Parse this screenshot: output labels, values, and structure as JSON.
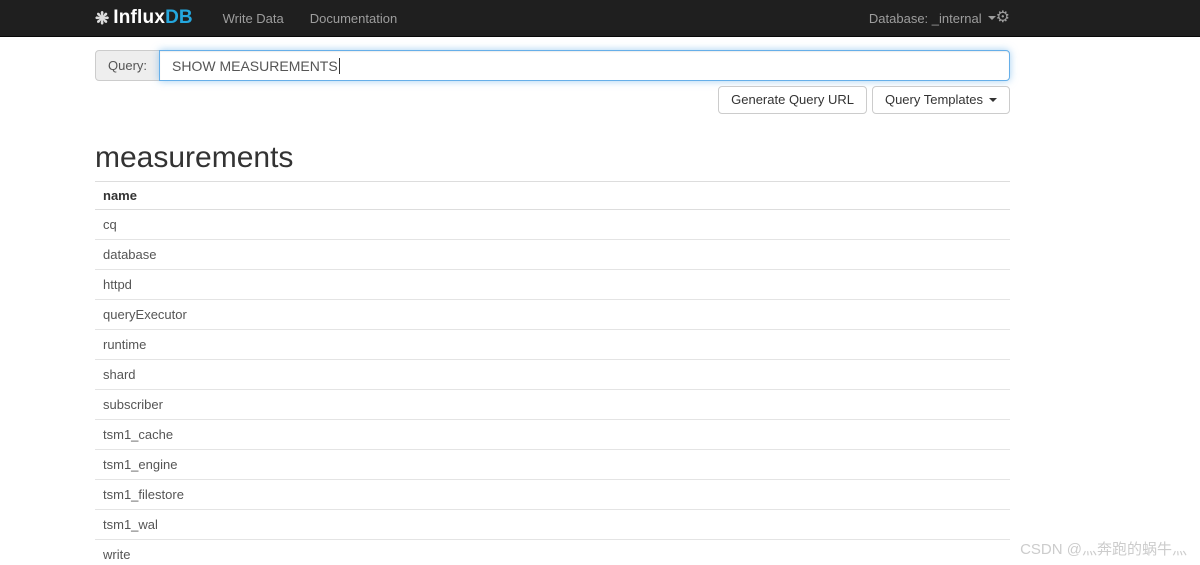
{
  "navbar": {
    "brand_influx": "Influx",
    "brand_db": "DB",
    "links": [
      {
        "label": "Write Data"
      },
      {
        "label": "Documentation"
      }
    ],
    "database_label": "Database: _internal"
  },
  "icons": {
    "logo_burst": "❋",
    "gear": "⚙"
  },
  "query_panel": {
    "label": "Query:",
    "value": "SHOW MEASUREMENTS"
  },
  "actions": {
    "generate_url": "Generate Query URL",
    "templates": "Query Templates"
  },
  "results": {
    "title": "measurements",
    "table": {
      "header": "name",
      "rows": [
        "cq",
        "database",
        "httpd",
        "queryExecutor",
        "runtime",
        "shard",
        "subscriber",
        "tsm1_cache",
        "tsm1_engine",
        "tsm1_filestore",
        "tsm1_wal",
        "write"
      ]
    }
  },
  "watermark": "CSDN @灬奔跑的蜗牛灬",
  "colors": {
    "navbar_bg": "#1f1f1f",
    "brand_blue": "#24a7de",
    "nav_text": "#9d9d9d",
    "focus_border": "#66afe9"
  }
}
